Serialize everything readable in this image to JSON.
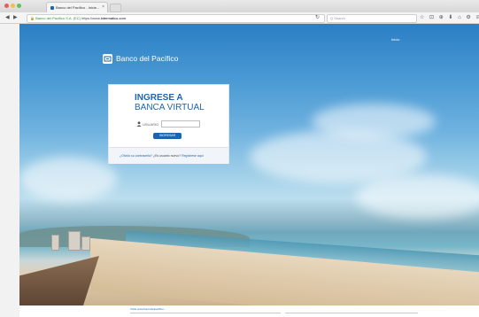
{
  "browser": {
    "tab_title": "Banco del Pacífico - Inicie...",
    "tab_close": "×",
    "url_org": "Banco del Pacifico S.A. (EC)",
    "url_prefix": "https://www.",
    "url_host": "intermatico.com",
    "search_placeholder": "Q Search",
    "toolbar_icons": "☆ ⊡ ⊕ ⬇ ⌂ ⚙ ≡",
    "nav_icons": [
      "back-icon",
      "forward-icon"
    ],
    "colors": {
      "tab_favicon": "#1d64ae",
      "secure": "#2e8b3a"
    }
  },
  "page": {
    "top_link": "Inicio",
    "logo_text": "Banco del Pacífico",
    "login": {
      "title_line1": "INGRESE A",
      "title_line2": "BANCA VIRTUAL",
      "user_label": "USUARIO",
      "user_value": "",
      "submit_label": "INGRESAR",
      "footer_links": [
        {
          "text": "¿Olvidó su contraseña?",
          "style": "link"
        },
        {
          "text": "¿Es usuario nuevo?",
          "style": "bold"
        },
        {
          "text": "Regístrese aquí",
          "style": "link"
        }
      ]
    },
    "footer": {
      "heading": "Visite www.bancodelpacifico..."
    },
    "colors": {
      "brand_blue": "#1d64ae",
      "sky": "#2a7fc4"
    }
  }
}
